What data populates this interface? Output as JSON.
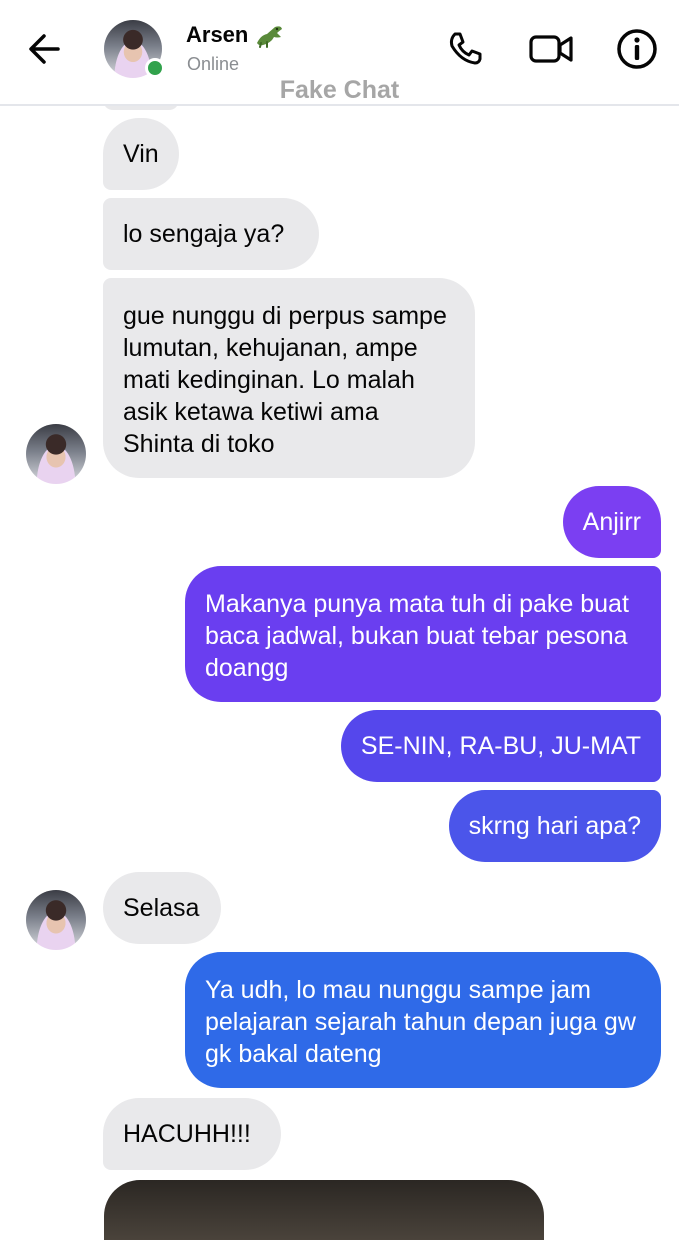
{
  "header": {
    "contact_name": "Arsen",
    "status": "Online",
    "watermark": "Fake Chat",
    "icons": {
      "back": "arrow-left-icon",
      "call": "phone-icon",
      "video": "video-camera-icon",
      "info": "info-icon",
      "name_emoji": "crocodile-icon"
    }
  },
  "messages": [
    {
      "from": "contact",
      "text": "Vin"
    },
    {
      "from": "contact",
      "text": "lo sengaja ya?"
    },
    {
      "from": "contact",
      "text": "gue nunggu di perpus sampe lumutan, kehujanan, ampe mati kedinginan. Lo malah asik ketawa ketiwi ama Shinta di toko"
    },
    {
      "from": "me",
      "text": "Anjirr"
    },
    {
      "from": "me",
      "text": "Makanya punya mata tuh di pake buat baca jadwal, bukan buat tebar pesona doangg"
    },
    {
      "from": "me",
      "text": "SE-NIN, RA-BU, JU-MAT"
    },
    {
      "from": "me",
      "text": "skrng hari apa?"
    },
    {
      "from": "contact",
      "text": "Selasa"
    },
    {
      "from": "me",
      "text": "Ya udh, lo mau nunggu sampe jam pelajaran sejarah tahun depan juga gw gk bakal dateng"
    },
    {
      "from": "contact",
      "text": "HACUHH!!!"
    }
  ],
  "colors": {
    "incoming_bubble": "#e9e9eb",
    "outgoing_gradient_top": "#7b3ff2",
    "outgoing_gradient_bottom": "#2f6ae8",
    "online": "#31a24c"
  }
}
